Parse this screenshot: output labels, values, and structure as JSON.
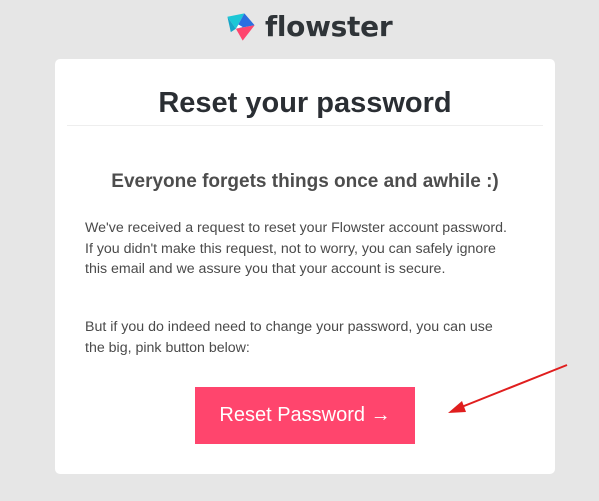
{
  "brand": {
    "name": "flowster",
    "logo_icon": "flowster-logo-icon",
    "colors": {
      "logo_teal": "#1cc7d6",
      "logo_blue": "#2c6fe0",
      "logo_pink": "#ff456d",
      "logo_text": "#2f3438"
    }
  },
  "email": {
    "title": "Reset your password",
    "subtitle": "Everyone forgets things once and awhile :)",
    "paragraph_1": "We've received a request to reset your Flowster account password. If you didn't make this request, not to worry, you can safely ignore this email and we assure you that your account is secure.",
    "paragraph_2": "But if you do indeed need to change your password, you can use the big, pink button below:",
    "button_label": "Reset Password →",
    "button_color": "#ff456d"
  },
  "annotation": {
    "icon": "red-arrow-pointer",
    "color": "#e01e1e"
  },
  "background_color": "#e6e6e6"
}
